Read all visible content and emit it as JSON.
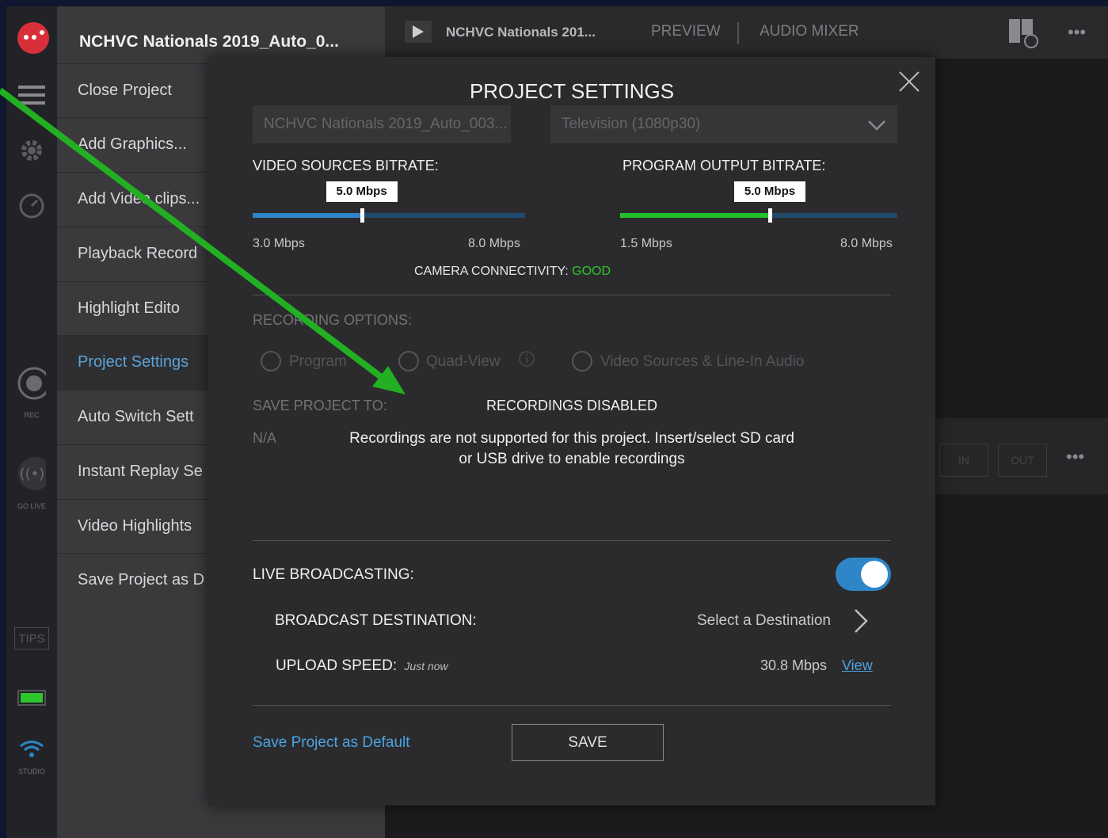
{
  "project_title": "NCHVC Nationals 2019_Auto_0...",
  "rail": {
    "rec_label": "REC",
    "golive_label": "GO LIVE",
    "tips_label": "TIPS",
    "studio_label": "STUDIO"
  },
  "menu": {
    "items": [
      {
        "label": "Close Project"
      },
      {
        "label": "Add Graphics..."
      },
      {
        "label": "Add Video clips..."
      },
      {
        "label": "Playback Record"
      },
      {
        "label": "Highlight Edito"
      },
      {
        "label": "Project Settings"
      },
      {
        "label": "Auto Switch Sett"
      },
      {
        "label": "Instant Replay Se"
      },
      {
        "label": "Video Highlights"
      },
      {
        "label": "Save Project as D"
      }
    ]
  },
  "topbar": {
    "title": "NCHVC Nationals 201...",
    "tab_preview": "PREVIEW",
    "tab_audio": "AUDIO MIXER",
    "in_label": "IN",
    "out_label": "OUT"
  },
  "modal": {
    "title": "PROJECT SETTINGS",
    "project_name": "NCHVC Nationals 2019_Auto_003...",
    "format": "Television (1080p30)",
    "video_bitrate": {
      "label": "VIDEO SOURCES BITRATE:",
      "value": "5.0 Mbps",
      "min": "3.0 Mbps",
      "max": "8.0 Mbps",
      "level": 0.4,
      "color": "#2e86c8"
    },
    "program_bitrate": {
      "label": "PROGRAM OUTPUT BITRATE:",
      "value": "5.0 Mbps",
      "min": "1.5 Mbps",
      "max": "8.0 Mbps",
      "level": 0.54,
      "color": "#22c22c"
    },
    "connectivity_label": "CAMERA CONNECTIVITY:",
    "connectivity_value": "GOOD",
    "connectivity_color": "#2ec52e",
    "recording_options_label": "RECORDING OPTIONS:",
    "options": [
      "Program",
      "Quad-View",
      "Video Sources & Line-In Audio"
    ],
    "save_to_label": "SAVE PROJECT TO:",
    "save_to_value": "N/A",
    "disabled_title": "RECORDINGS DISABLED",
    "disabled_line1": "Recordings are not supported for this project. Insert/select SD card",
    "disabled_line2": "or USB drive to enable recordings",
    "live_label": "LIVE BROADCASTING:",
    "live_enabled": true,
    "destination_label": "BROADCAST DESTINATION:",
    "destination_value": "Select a Destination",
    "upload_label": "UPLOAD SPEED:",
    "upload_time": "Just now",
    "upload_value": "30.8 Mbps",
    "view_link": "View",
    "save_default": "Save Project as Default",
    "save_button": "SAVE"
  },
  "colors": {
    "accent": "#2e86c8",
    "annotation_arrow": "#22b022"
  }
}
